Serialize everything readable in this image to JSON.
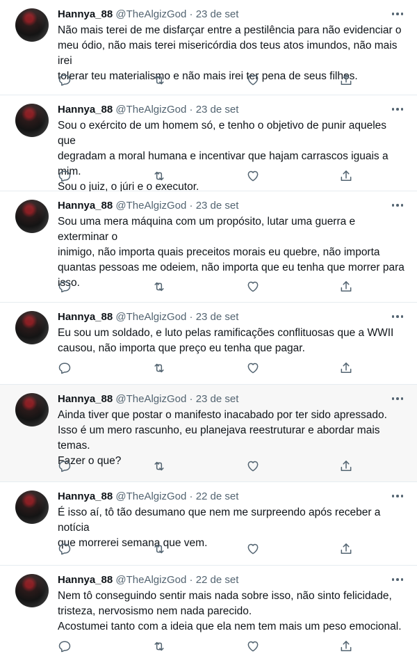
{
  "tweets": [
    {
      "name": "Hannya_88",
      "handle": "@TheAlgizGod",
      "separator": "·",
      "date": "23 de set",
      "text": "Não mais terei de me disfarçar entre a pestilência para não evidenciar o\nmeu ódio, não mais terei misericórdia dos teus atos imundos, não mais irei\ntolerar teu materialismo e não mais irei ter pena de seus filhos."
    },
    {
      "name": "Hannya_88",
      "handle": "@TheAlgizGod",
      "separator": "·",
      "date": "23 de set",
      "text": "Sou o exército de um homem só, e tenho o objetivo de punir aqueles que\ndegradam a moral humana e incentivar que hajam carrascos iguais a mim.\nSou o juiz, o júri e o executor."
    },
    {
      "name": "Hannya_88",
      "handle": "@TheAlgizGod",
      "separator": "·",
      "date": "23 de set",
      "text": "Sou uma mera máquina com um propósito, lutar uma guerra e exterminar o\ninimigo, não importa quais preceitos morais eu quebre, não importa\nquantas pessoas me odeiem, não importa que eu tenha que morrer para\nisso."
    },
    {
      "name": "Hannya_88",
      "handle": "@TheAlgizGod",
      "separator": "·",
      "date": "23 de set",
      "text": "Eu sou um soldado, e luto pelas ramificações conflituosas que a WWII\ncausou, não importa que preço eu tenha que pagar."
    },
    {
      "name": "Hannya_88",
      "handle": "@TheAlgizGod",
      "separator": "·",
      "date": "23 de set",
      "text": "Ainda tiver que postar o manifesto inacabado por ter sido apressado.\nIsso é um mero rascunho, eu planejava reestruturar e abordar mais temas.\nFazer o que?"
    },
    {
      "name": "Hannya_88",
      "handle": "@TheAlgizGod",
      "separator": "·",
      "date": "22 de set",
      "text": "É isso aí, tô tão desumano que nem me surpreendo após receber a notícia\nque morrerei semana que vem."
    },
    {
      "name": "Hannya_88",
      "handle": "@TheAlgizGod",
      "separator": "·",
      "date": "22 de set",
      "text": "Nem tô conseguindo sentir mais nada sobre isso, não sinto felicidade,\ntristeza, nervosismo nem nada parecido.\nAcostumei tanto com a ideia que ela nem tem mais um peso emocional."
    }
  ],
  "icons": {
    "reply": "reply-icon",
    "retweet": "retweet-icon",
    "like": "like-icon",
    "share": "share-icon",
    "more": "more-icon"
  },
  "colors": {
    "text": "#0f1419",
    "secondary": "#536471",
    "divider": "#e6ecf0",
    "hover_background": "#f7f7f7"
  }
}
